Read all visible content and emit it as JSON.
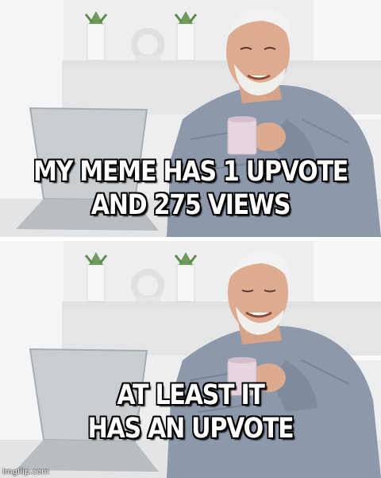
{
  "top_caption": {
    "line1": "MY MEME HAS 1 UPVOTE",
    "line2": "AND 275 VIEWS"
  },
  "bottom_caption": {
    "line1": "AT LEAST IT",
    "line2": "HAS AN UPVOTE"
  },
  "watermark": "imgflip.com",
  "colors": {
    "wall": "#eceeef",
    "shirt": "#8d98aa",
    "laptop": "#c9ccd0",
    "mug": "#e6d4de",
    "caption_text": "#ffffff",
    "caption_outline": "#000000"
  }
}
